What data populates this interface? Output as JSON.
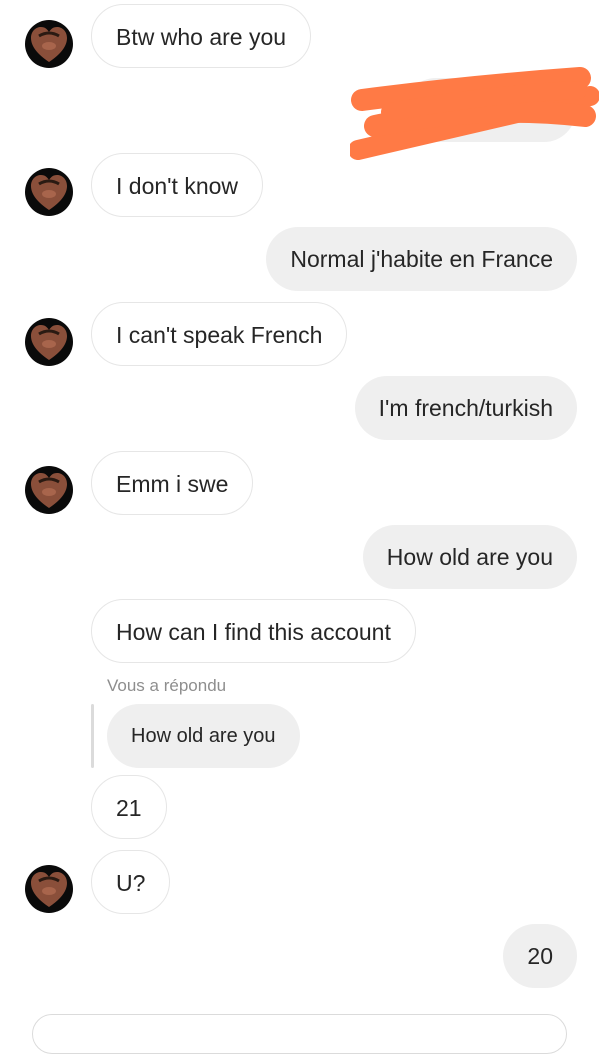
{
  "conversation": {
    "messages": [
      {
        "direction": "incoming",
        "text": "Btw who are you"
      },
      {
        "direction": "outgoing",
        "text": "",
        "redacted": true
      },
      {
        "direction": "incoming",
        "text": "I don't know"
      },
      {
        "direction": "outgoing",
        "text": "Normal j'habite en France"
      },
      {
        "direction": "incoming",
        "text": "I can't speak French"
      },
      {
        "direction": "outgoing",
        "text": "I'm french/turkish"
      },
      {
        "direction": "incoming",
        "text": "Emm i swe"
      },
      {
        "direction": "outgoing",
        "text": "How old are you"
      },
      {
        "direction": "incoming",
        "text": "How can I find this account"
      },
      {
        "direction": "incoming",
        "text": "21"
      },
      {
        "direction": "incoming",
        "text": "U?"
      },
      {
        "direction": "outgoing",
        "text": "20"
      }
    ],
    "reply": {
      "label": "Vous a répondu",
      "quoted_text": "How old are you"
    }
  },
  "colors": {
    "incoming_bubble": "#ffffff",
    "incoming_border": "#e6e6e6",
    "outgoing_bubble": "#efefef",
    "text": "#262626",
    "muted_text": "#8e8e8e",
    "redaction": "#ff7a45"
  },
  "icons": {
    "avatar": "contact-avatar-photo"
  }
}
